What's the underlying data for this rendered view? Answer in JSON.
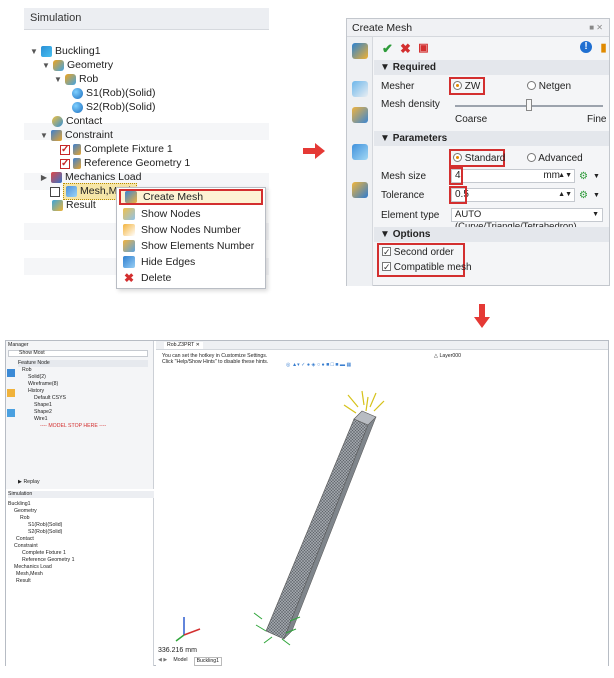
{
  "simulation_panel": {
    "title": "Simulation",
    "tree": {
      "root": "Buckling1",
      "geometry": "Geometry",
      "rob": "Rob",
      "solid1": "S1(Rob)(Solid)",
      "solid2": "S2(Rob)(Solid)",
      "contact": "Contact",
      "constraint": "Constraint",
      "fixture": "Complete Fixture 1",
      "reference": "Reference Geometry 1",
      "loads": "Mechanics Load",
      "mesh": "Mesh,Mesh",
      "result": "Result"
    },
    "context_menu": [
      {
        "label": "Create Mesh",
        "icon": "create-mesh-icon"
      },
      {
        "label": "Show Nodes",
        "icon": "show-nodes-icon"
      },
      {
        "label": "Show Nodes Number",
        "icon": "nodes-number-icon"
      },
      {
        "label": "Show Elements Number",
        "icon": "elements-number-icon"
      },
      {
        "label": "Hide Edges",
        "icon": "hide-edges-icon"
      },
      {
        "label": "Delete",
        "icon": "delete-icon"
      }
    ]
  },
  "create_mesh": {
    "title": "Create Mesh",
    "required": "Required",
    "mesher_label": "Mesher",
    "mesher_zw": "ZW",
    "mesher_netgen": "Netgen",
    "density_label": "Mesh density",
    "coarse": "Coarse",
    "fine": "Fine",
    "parameters": "Parameters",
    "standard": "Standard",
    "advanced": "Advanced",
    "mesh_size_label": "Mesh size",
    "mesh_size_value": "4",
    "mesh_size_unit": "mm",
    "tolerance_label": "Tolerance",
    "tolerance_value": "0.5",
    "element_type_label": "Element type",
    "element_type_value": "AUTO (Curve/Triangle/Tetrahedron)",
    "options": "Options",
    "second_order": "Second order",
    "compatible_mesh": "Compatible mesh",
    "mesh_density_level": 0.5
  },
  "app_screenshot": {
    "manager_title": "Manager",
    "show_mode": "Show Most",
    "feature_node": "Feature Node",
    "feature_items": [
      "Rob",
      "Solid(2)",
      "Wireframe(8)",
      "History",
      "Default CSYS",
      "Shape1",
      "Shape2",
      "Wire1",
      "---- MODEL STOP HERE ----"
    ],
    "replay": "Replay",
    "simulation_title": "Simulation",
    "sim_items": [
      "Buckling1",
      "Geometry",
      "Rob",
      "S1(Rob)(Solid)",
      "S2(Rob)(Solid)",
      "Contact",
      "Constraint",
      "Complete Fixture 1",
      "Reference Geometry 1",
      "Mechanics Load",
      "Mesh,Mesh",
      "Result"
    ],
    "tab_name": "Rob.Z3PRT",
    "hint_line1": "You can set the hotkey in Customize Settings.",
    "hint_line2": "Click \"Help/Show Hints\" to disable these hints.",
    "layer": "Layer000",
    "scale_text": "336.216 mm",
    "bottom_tabs": [
      "Model",
      "Buckling1"
    ]
  }
}
